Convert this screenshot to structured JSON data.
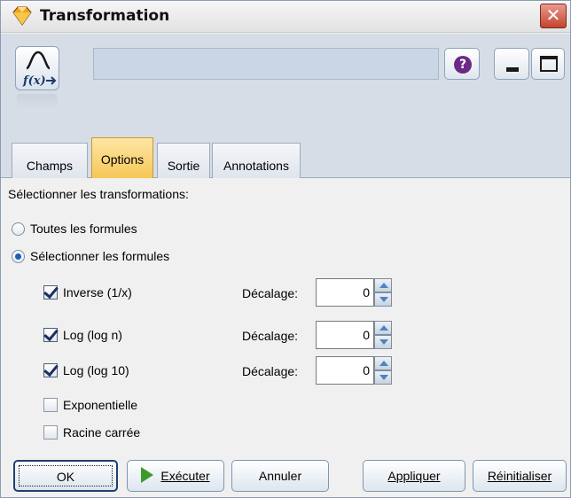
{
  "window": {
    "title": "Transformation",
    "close_symbol": "✕"
  },
  "header": {
    "help_symbol": "?"
  },
  "tabs": [
    {
      "label": "Champs",
      "active": false
    },
    {
      "label": "Options",
      "active": true
    },
    {
      "label": "Sortie",
      "active": false
    },
    {
      "label": "Annotations",
      "active": false
    }
  ],
  "options": {
    "section_label": "Sélectionner les transformations:",
    "radios": [
      {
        "label": "Toutes les formules",
        "checked": false
      },
      {
        "label": "Sélectionner les formules",
        "checked": true
      }
    ],
    "offset_label": "Décalage:",
    "transforms": [
      {
        "label": "Inverse (1/x)",
        "checked": true,
        "offset": "0"
      },
      {
        "label": "Log (log n)",
        "checked": true,
        "offset": "0"
      },
      {
        "label": "Log (log 10)",
        "checked": true,
        "offset": "0"
      },
      {
        "label": "Exponentielle",
        "checked": false
      },
      {
        "label": "Racine carrée",
        "checked": false
      }
    ]
  },
  "footer": {
    "ok_label": "OK",
    "run_label": "Exécuter",
    "cancel_label": "Annuler",
    "apply_label": "Appliquer",
    "reset_label": "Réinitialiser"
  },
  "colors": {
    "active_tab": "#f7c757",
    "header_bg": "#d6dde6",
    "checkmark": "#1c2f5e",
    "run_icon": "#3c9a2c"
  }
}
